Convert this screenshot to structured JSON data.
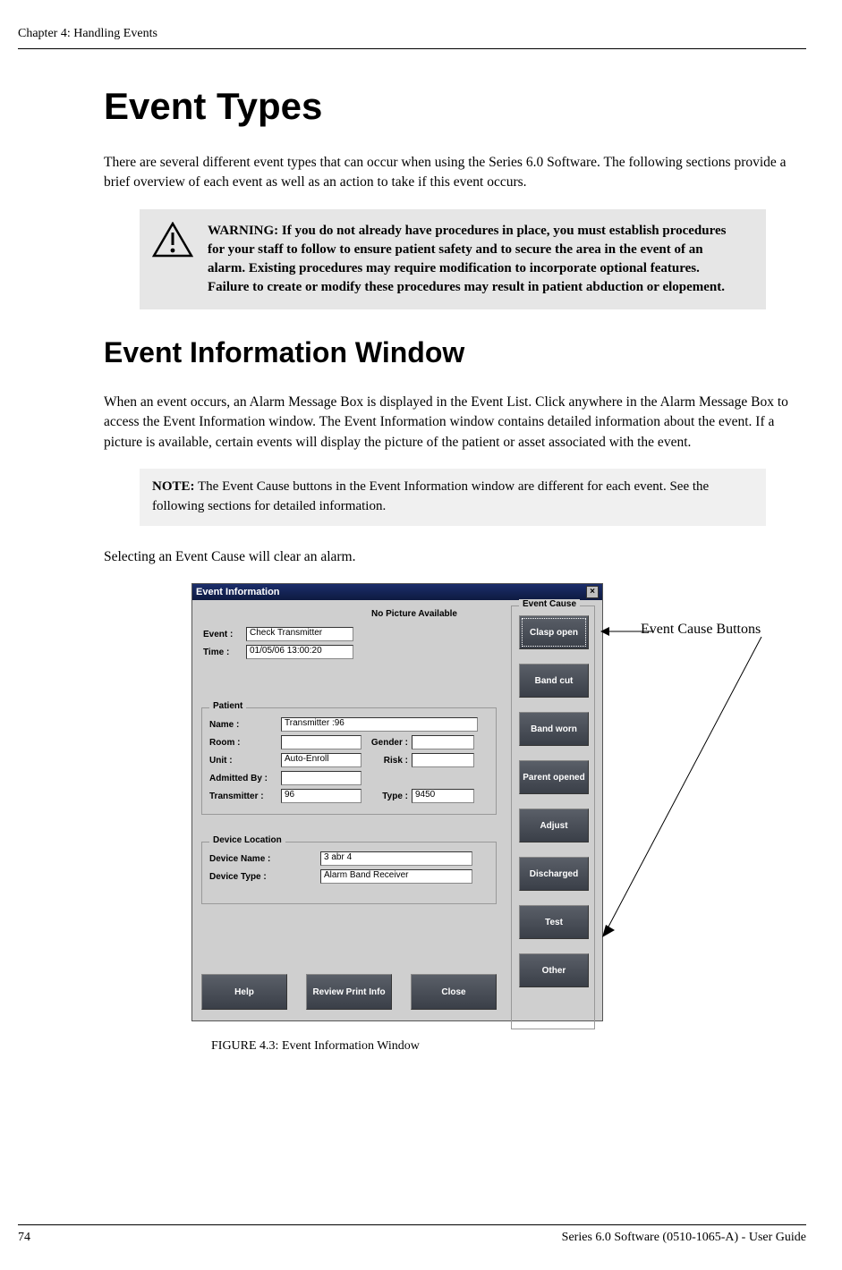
{
  "header": {
    "chapter_label": "Chapter 4: Handling Events"
  },
  "h1": "Event Types",
  "intro": "There are several different event types that can occur when using the Series 6.0 Software. The following sections provide a brief overview of each event as well as an action to take if this event occurs.",
  "warning": {
    "text": "WARNING: If you do not already have procedures in place, you must establish procedures for your staff to follow to ensure patient safety and to secure the area in the event of an alarm. Existing procedures may require modification to incorporate optional features. Failure to create or modify these procedures may result in patient abduction or elopement."
  },
  "h2": "Event Information Window",
  "p2": "When an event occurs, an Alarm Message Box is displayed in the Event List. Click anywhere in the Alarm Message Box to access the Event Information window. The Event Information window contains detailed information about the event. If a picture is available, certain events will display the picture of the patient or asset associated with the event.",
  "note": {
    "label": "NOTE:",
    "text": " The Event Cause buttons in the Event Information window are different for each event. See the following sections for detailed information."
  },
  "p3": "Selecting an Event Cause will clear an alarm.",
  "dialog": {
    "title": "Event Information",
    "no_pic": "No Picture Available",
    "labels": {
      "event": "Event :",
      "time": "Time :",
      "patient_group": "Patient",
      "name": "Name :",
      "room": "Room :",
      "gender": "Gender :",
      "unit": "Unit :",
      "risk": "Risk :",
      "admitted": "Admitted By :",
      "transmitter": "Transmitter :",
      "type": "Type :",
      "device_group": "Device Location",
      "device_name": "Device Name :",
      "device_type": "Device Type :",
      "cause_group": "Event Cause"
    },
    "values": {
      "event": "Check Transmitter",
      "time": "01/05/06 13:00:20",
      "name": "Transmitter :96",
      "room": "",
      "gender": "",
      "unit": "Auto-Enroll",
      "risk": "",
      "admitted": "",
      "transmitter": "96",
      "type": "9450",
      "device_name": "3 abr 4",
      "device_type": "Alarm Band Receiver"
    },
    "cause_buttons": [
      "Clasp open",
      "Band cut",
      "Band worn",
      "Parent opened",
      "Adjust",
      "Discharged",
      "Test",
      "Other"
    ],
    "bottom_buttons": {
      "help": "Help",
      "review": "Review Print Info",
      "close": "Close"
    }
  },
  "callout": "Event Cause Buttons",
  "figure_caption": "FIGURE 4.3:    Event Information Window",
  "footer": {
    "page": "74",
    "doc": "Series 6.0 Software (0510-1065-A) - User Guide"
  }
}
